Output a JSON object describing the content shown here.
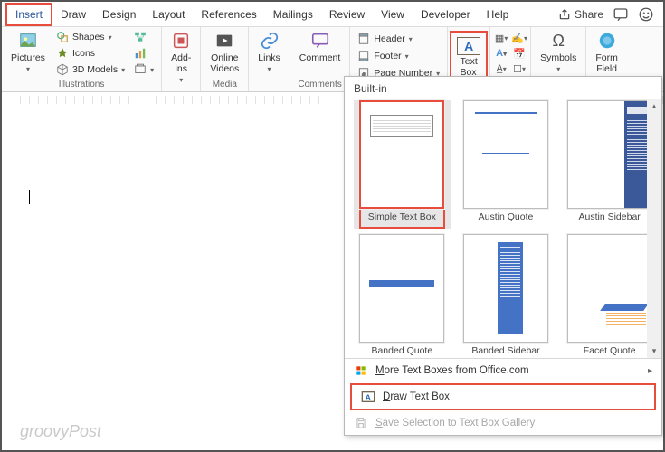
{
  "tabs": {
    "insert": "Insert",
    "draw": "Draw",
    "design": "Design",
    "layout": "Layout",
    "references": "References",
    "mailings": "Mailings",
    "review": "Review",
    "view": "View",
    "developer": "Developer",
    "help": "Help"
  },
  "top_right": {
    "share": "Share"
  },
  "ribbon": {
    "illustrations": {
      "pictures": "Pictures",
      "shapes": "Shapes",
      "icons": "Icons",
      "models3d": "3D Models",
      "smartart": "",
      "chart": "",
      "screenshot": "",
      "label": "Illustrations"
    },
    "addins": {
      "addins": "Add-\nins",
      "label": ""
    },
    "media": {
      "online_videos": "Online\nVideos",
      "label": "Media"
    },
    "links": {
      "links": "Links",
      "label": ""
    },
    "comments": {
      "comment": "Comment",
      "label": "Comments"
    },
    "header_footer": {
      "header": "Header",
      "footer": "Footer",
      "page_number": "Page Number"
    },
    "text": {
      "textbox": "Text\nBox"
    },
    "symbols": {
      "symbols": "Symbols",
      "label": ""
    },
    "form": {
      "form_field": "Form\nField",
      "label": ""
    }
  },
  "dropdown": {
    "section": "Built-in",
    "items": [
      "Simple Text Box",
      "Austin Quote",
      "Austin Sidebar",
      "Banded Quote",
      "Banded Sidebar",
      "Facet Quote"
    ],
    "more_word": "More Text Boxes from Office.com",
    "more_letter": "M",
    "draw_word": "Draw Text Box",
    "draw_letter": "D",
    "save_word": "Save Selection to Text Box Gallery",
    "save_letter": "S"
  },
  "watermark": "groovyPost"
}
